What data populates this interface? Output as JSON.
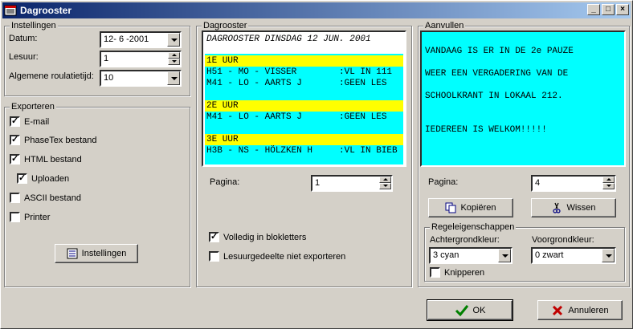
{
  "window": {
    "title": "Dagrooster"
  },
  "instellingen": {
    "group_label": "Instellingen",
    "datum_label": "Datum:",
    "datum_value": "12- 6 -2001",
    "lesuur_label": "Lesuur:",
    "lesuur_value": "1",
    "roulatie_label": "Algemene roulatietijd:",
    "roulatie_value": "10"
  },
  "exporteren": {
    "group_label": "Exporteren",
    "items": [
      {
        "label": "E-mail",
        "checked": true
      },
      {
        "label": "PhaseTex bestand",
        "checked": true
      },
      {
        "label": "HTML bestand",
        "checked": true
      },
      {
        "label": "Uploaden",
        "checked": true
      },
      {
        "label": "ASCII bestand",
        "checked": false
      },
      {
        "label": "Printer",
        "checked": false
      }
    ],
    "settings_button": "Instellingen"
  },
  "dagrooster": {
    "group_label": "Dagrooster",
    "header": "DAGROOSTER DINSDAG 12 JUN. 2001",
    "lines": [
      "1E UUR",
      "H51 - MO - VISSER        :VL IN 111",
      "M41 - LO - AARTS J       :GEEN LES",
      "2E UUR",
      "M41 - LO - AARTS J       :GEEN LES",
      "3E UUR",
      "H3B - NS - HÖLZKEN H     :VL IN BIEB"
    ],
    "pagina_label": "Pagina:",
    "pagina_value": "1",
    "blokletters_label": "Volledig in blokletters",
    "blokletters_checked": true,
    "lesuur_label": "Lesuurgedeelte niet exporteren",
    "lesuur_checked": false
  },
  "aanvullen": {
    "group_label": "Aanvullen",
    "lines": [
      "VANDAAG IS ER IN DE 2e PAUZE",
      "WEER EEN VERGADERING VAN DE",
      "SCHOOLKRANT IN LOKAAL 212.",
      "IEDEREEN IS WELKOM!!!!!"
    ],
    "pagina_label": "Pagina:",
    "pagina_value": "4",
    "kopieren_button": "Kopiëren",
    "wissen_button": "Wissen",
    "regel_group_label": "Regeleigenschappen",
    "achtergrond_label": "Achtergrondkleur:",
    "achtergrond_value": "3 cyan",
    "voorgrond_label": "Voorgrondkleur:",
    "voorgrond_value": "0 zwart",
    "knipperen_label": "Knipperen",
    "knipperen_checked": false
  },
  "footer": {
    "ok_button": "OK",
    "cancel_button": "Annuleren"
  },
  "colors": {
    "highlight": "#ffff00",
    "background": "#00ffff",
    "title": "#0a246a"
  }
}
